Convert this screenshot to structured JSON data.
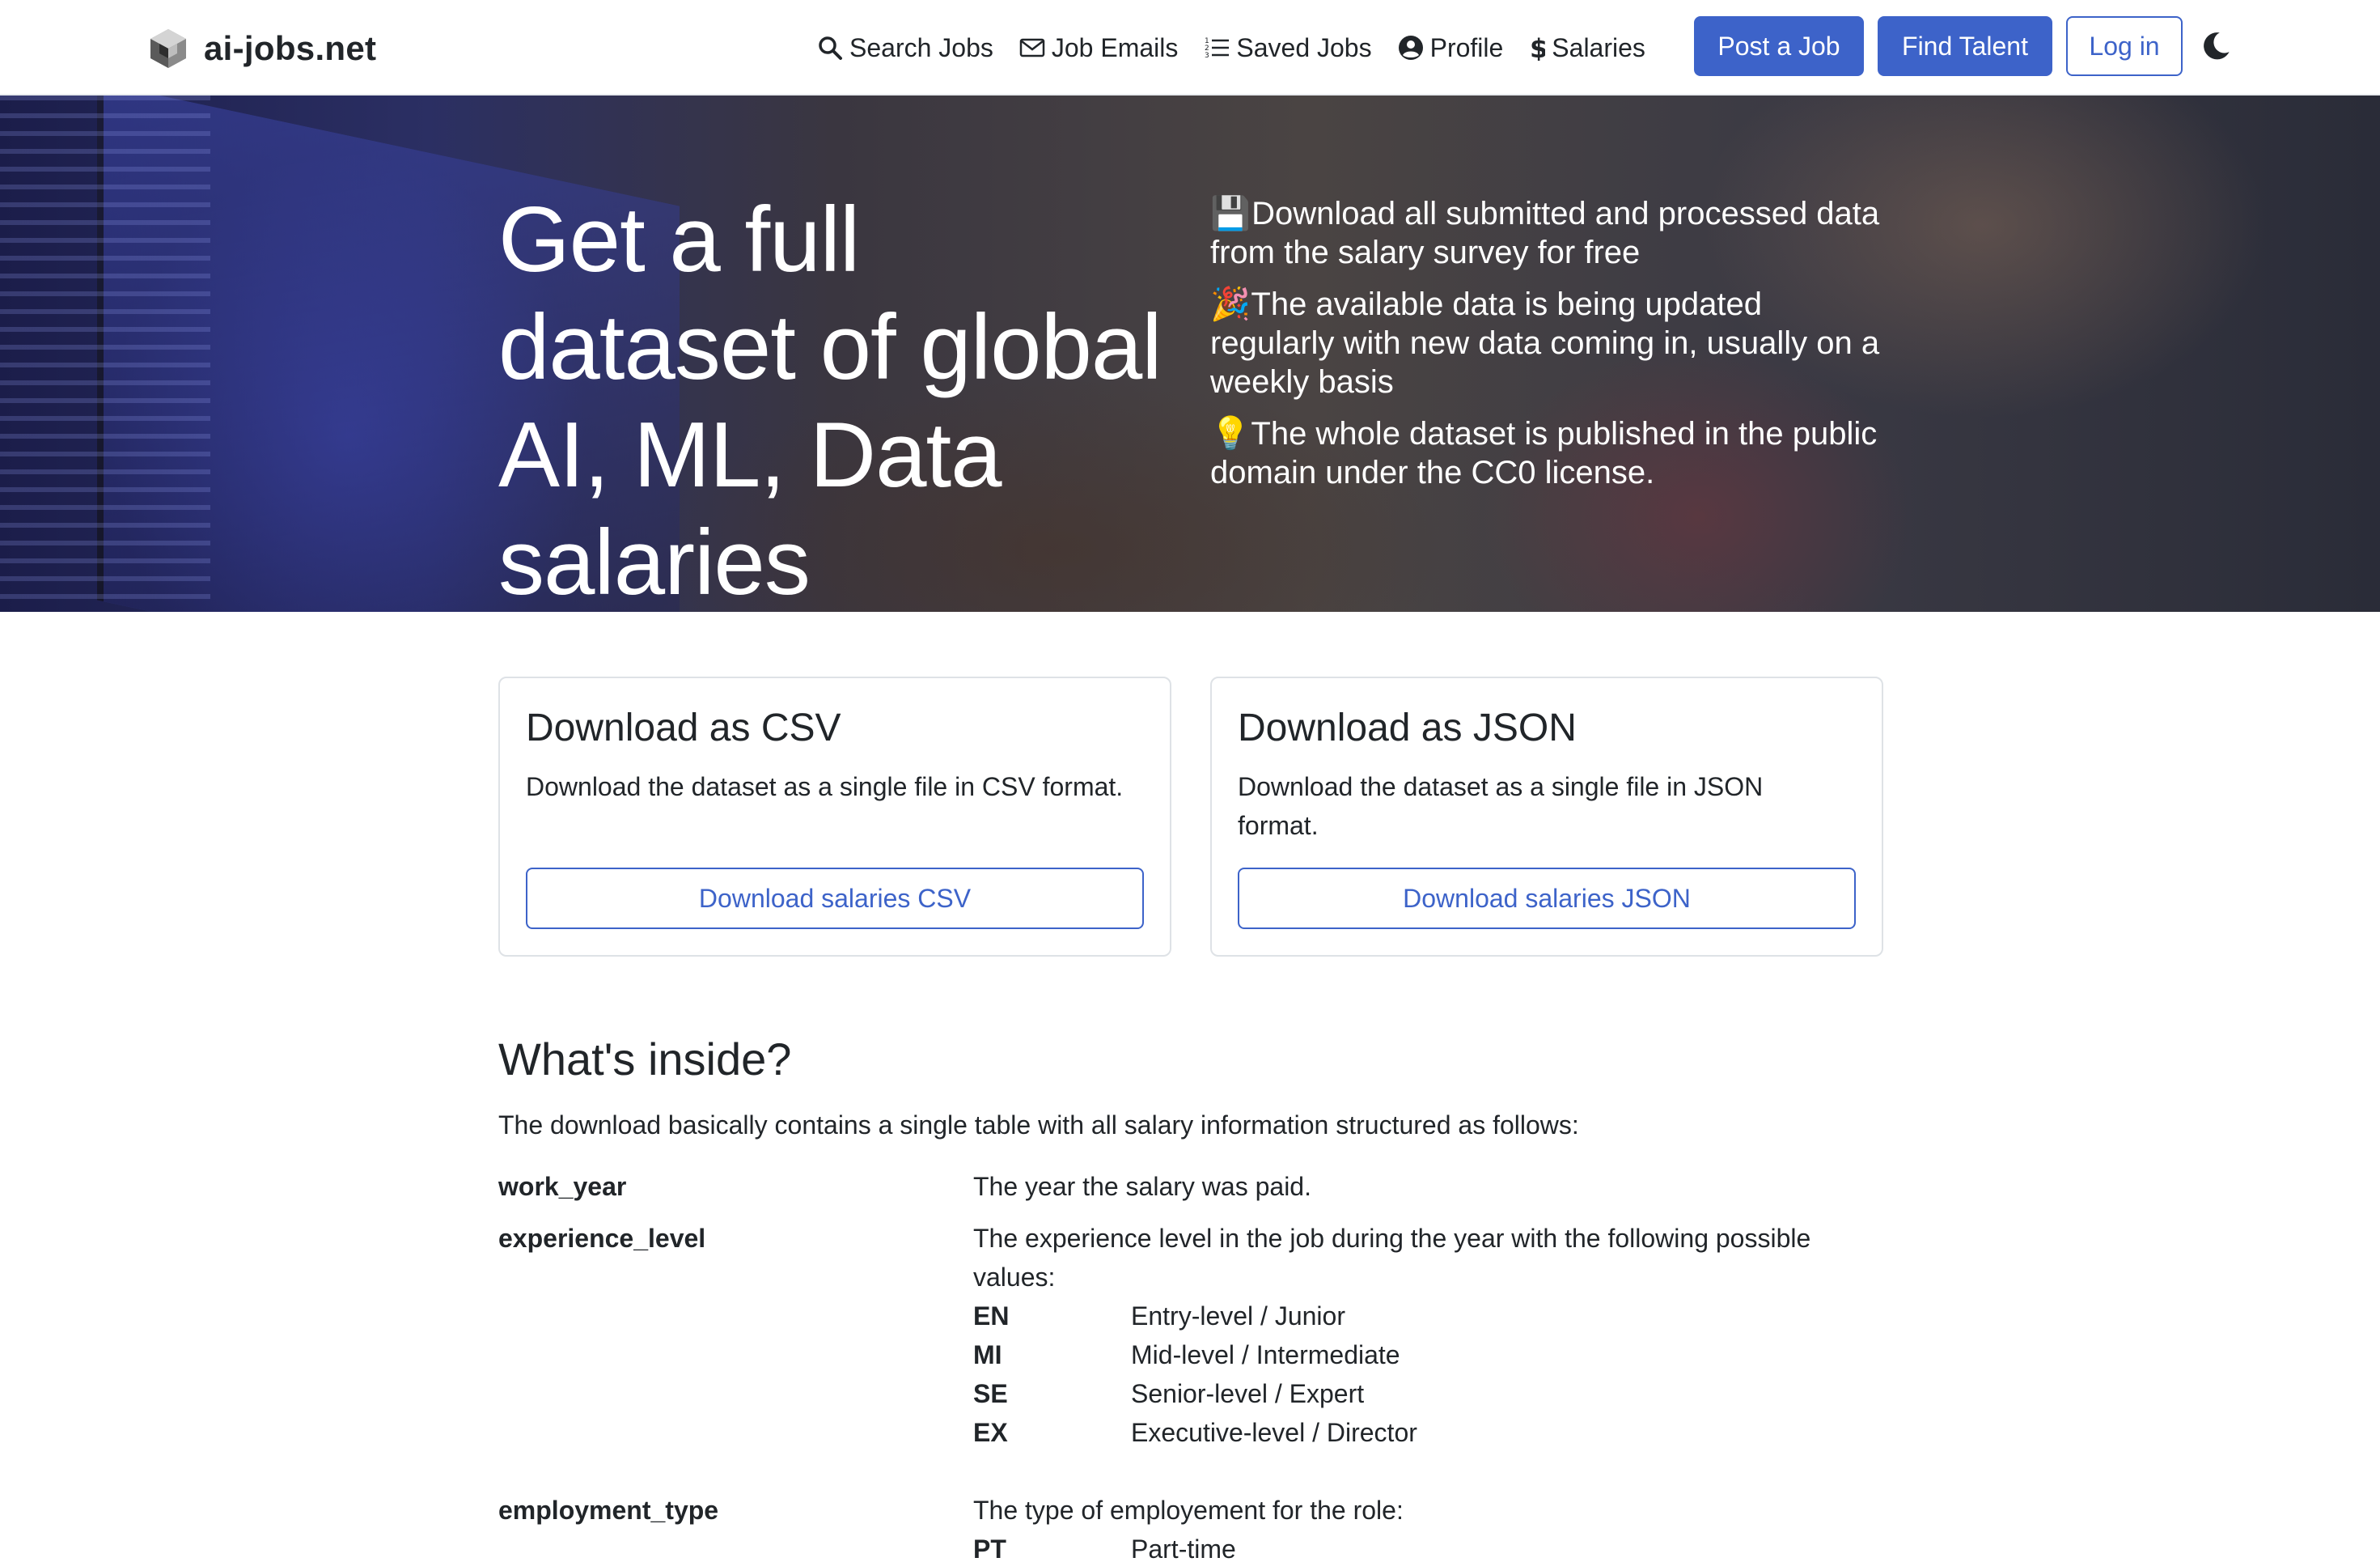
{
  "brand": {
    "name": "ai-jobs.net"
  },
  "nav": {
    "links": [
      {
        "label": "Search Jobs",
        "icon": "search-icon"
      },
      {
        "label": "Job Emails",
        "icon": "envelope-icon"
      },
      {
        "label": "Saved Jobs",
        "icon": "list-icon"
      },
      {
        "label": "Profile",
        "icon": "user-circle-icon"
      },
      {
        "label": "Salaries",
        "icon": "dollar-icon"
      }
    ],
    "post_job": "Post a Job",
    "find_talent": "Find Talent",
    "login": "Log in",
    "theme_toggle_icon": "moon-icon"
  },
  "hero": {
    "title": "Get a full dataset of global AI, ML, Data salaries",
    "points": [
      {
        "emoji": "💾",
        "text": "Download all submitted and processed data from the salary survey for free"
      },
      {
        "emoji": "🎉",
        "text": "The available data is being updated regularly with new data coming in, usually on a weekly basis"
      },
      {
        "emoji": "💡",
        "text": "The whole dataset is published in the public domain under the CC0 license."
      }
    ]
  },
  "cards": [
    {
      "title": "Download as CSV",
      "text": "Download the dataset as a single file in CSV format.",
      "button": "Download salaries CSV"
    },
    {
      "title": "Download as JSON",
      "text": "Download the dataset as a single file in JSON format.",
      "button": "Download salaries JSON"
    }
  ],
  "inside": {
    "title": "What's inside?",
    "intro": "The download basically contains a single table with all salary information structured as follows:",
    "fields": [
      {
        "name": "work_year",
        "description": "The year the salary was paid."
      },
      {
        "name": "experience_level",
        "description": "The experience level in the job during the year with the following possible values:",
        "values": [
          {
            "code": "EN",
            "label": "Entry-level / Junior"
          },
          {
            "code": "MI",
            "label": "Mid-level / Intermediate"
          },
          {
            "code": "SE",
            "label": "Senior-level / Expert"
          },
          {
            "code": "EX",
            "label": "Executive-level / Director"
          }
        ]
      },
      {
        "name": "employment_type",
        "description": "The type of employement for the role:",
        "values": [
          {
            "code": "PT",
            "label": "Part-time"
          }
        ]
      }
    ]
  },
  "colors": {
    "primary": "#3d63c9",
    "text": "#212529",
    "border": "#dee2e6"
  }
}
